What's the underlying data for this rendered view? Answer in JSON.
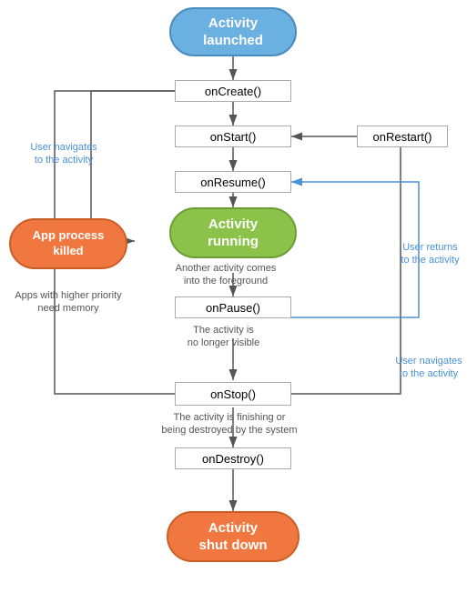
{
  "nodes": {
    "activity_launched": {
      "label": "Activity\nlaunched",
      "bg": "#6ab0e0",
      "border": "#4a8bbf"
    },
    "on_create": {
      "label": "onCreate()"
    },
    "on_start": {
      "label": "onStart()"
    },
    "on_resume": {
      "label": "onResume()"
    },
    "activity_running": {
      "label": "Activity\nrunning",
      "bg": "#8bc34a",
      "border": "#6a9e35"
    },
    "on_pause": {
      "label": "onPause()"
    },
    "on_stop": {
      "label": "onStop()"
    },
    "on_destroy": {
      "label": "onDestroy()"
    },
    "activity_shut_down": {
      "label": "Activity\nshut down",
      "bg": "#f07840",
      "border": "#c95e28"
    },
    "app_process_killed": {
      "label": "App process\nkilled",
      "bg": "#f07840",
      "border": "#c95e28"
    },
    "on_restart": {
      "label": "onRestart()"
    }
  },
  "labels": {
    "user_navigates_to": "User navigates\nto the activity",
    "another_activity": "Another activity comes\ninto the foreground",
    "apps_higher_priority": "Apps with higher priority\nneed memory",
    "no_longer_visible": "The activity is\nno longer visible",
    "finishing_or_destroyed": "The activity is finishing or\nbeing destroyed by the system",
    "user_returns": "User returns\nto the activity",
    "user_navigates_to2": "User navigates\nto the activity"
  }
}
